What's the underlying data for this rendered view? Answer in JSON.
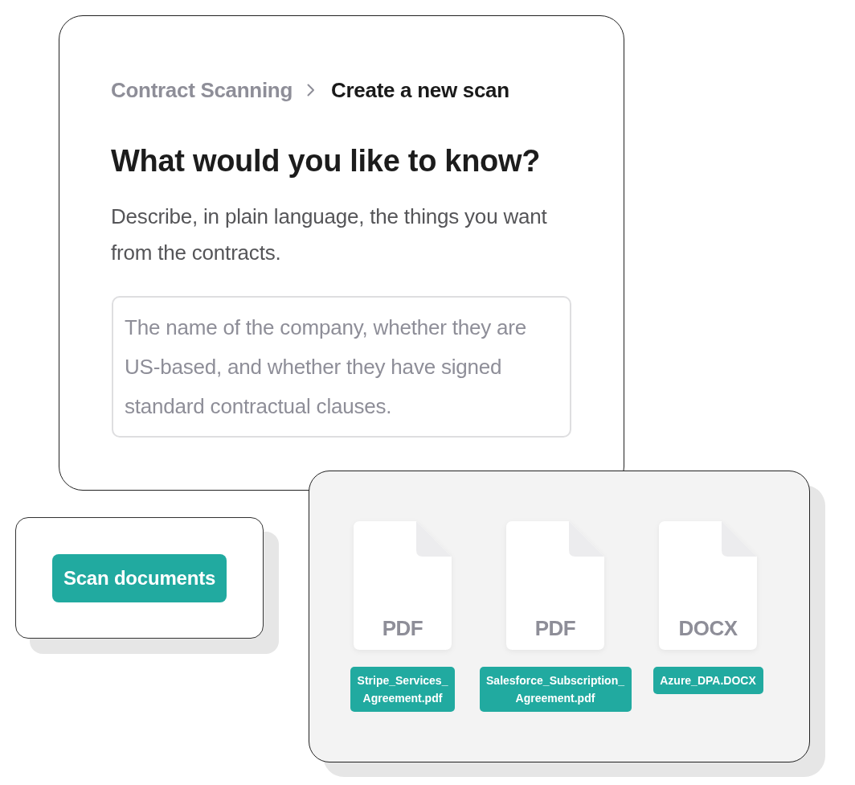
{
  "breadcrumb": [
    {
      "label": "Contract Scanning",
      "current": false
    },
    {
      "label": "Create a new scan",
      "current": true
    }
  ],
  "heading": "What would you like to know?",
  "description": "Describe, in plain language, the things you want from the contracts.",
  "query_field": {
    "placeholder": "The name of the company, whether they are US-based, and whether they have signed standard contractual clauses."
  },
  "scan_button": {
    "label": "Scan documents"
  },
  "files": [
    {
      "type": "PDF",
      "name": "Stripe_Services_Agreement.pdf"
    },
    {
      "type": "PDF",
      "name": "Salesforce_Subscription_Agreement.pdf"
    },
    {
      "type": "DOCX",
      "name": "Azure_DPA.DOCX"
    }
  ]
}
